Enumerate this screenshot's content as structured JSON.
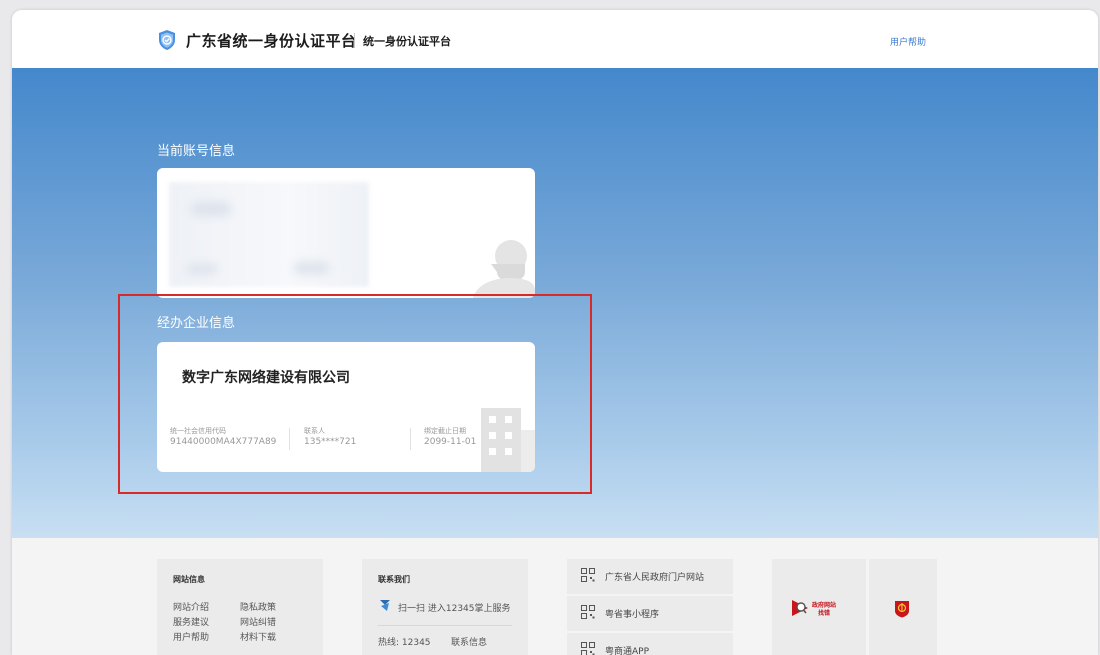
{
  "header": {
    "title": "广东省统一身份认证平台",
    "subtitle": "统一身份认证平台",
    "help": "用户帮助"
  },
  "account": {
    "section_label": "当前账号信息"
  },
  "enterprise": {
    "section_label": "经办企业信息",
    "company_name": "数字广东网络建设有限公司",
    "credit_code_label": "统一社会信用代码",
    "credit_code_value": "91440000MA4X777A89",
    "contact_label": "联系人",
    "contact_value": "135****721",
    "deadline_label": "绑定截止日期",
    "deadline_value": "2099-11-01"
  },
  "footer": {
    "site_info": {
      "title": "网站信息",
      "links": [
        "网站介绍",
        "隐私政策",
        "服务建议",
        "网站纠错",
        "用户帮助",
        "材料下载"
      ]
    },
    "contact": {
      "title": "联系我们",
      "scan": "扫一扫 进入12345掌上服务",
      "hotline": "热线: 12345",
      "contact_info": "联系信息"
    },
    "qr_links": [
      "广东省人民政府门户网站",
      "粤省事小程序",
      "粤商通APP"
    ],
    "badge": {
      "line1": "政府网站",
      "line2": "找错"
    }
  },
  "colors": {
    "accent": "#3b7bd0",
    "highlight": "#d92a2a",
    "hero_top": "#4488cc",
    "hero_bottom": "#c8dff3"
  }
}
